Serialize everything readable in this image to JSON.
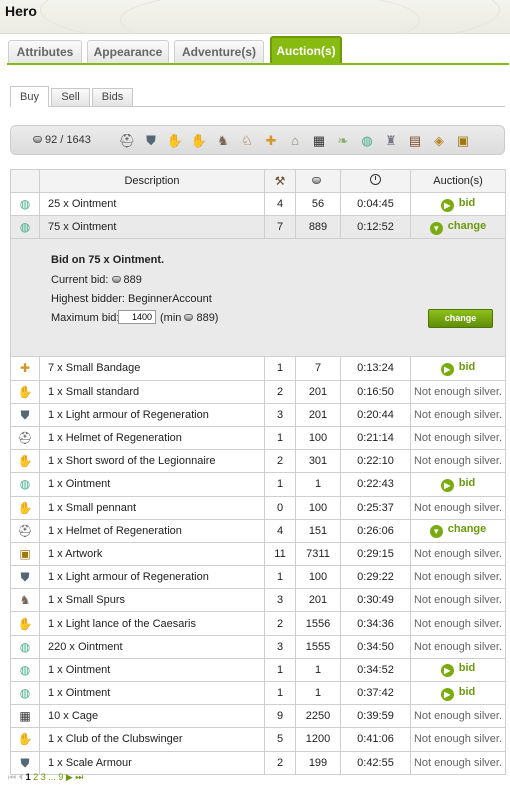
{
  "header": {
    "title": "Hero"
  },
  "main_tabs": [
    {
      "label": "Attributes",
      "active": false
    },
    {
      "label": "Appearance",
      "active": false
    },
    {
      "label": "Adventure(s)",
      "active": false
    },
    {
      "label": "Auction(s)",
      "active": true
    }
  ],
  "sub_tabs": [
    {
      "label": "Buy",
      "active": true
    },
    {
      "label": "Sell",
      "active": false
    },
    {
      "label": "Bids",
      "active": false
    }
  ],
  "filter_bar": {
    "silver": "92 / 1643",
    "icons": [
      "helmet-icon",
      "armour-icon",
      "left-hand-icon",
      "right-hand-icon",
      "shoes-icon",
      "horse-icon",
      "bandage-icon",
      "bird-cage-icon",
      "cage-icon",
      "scroll-icon",
      "ointment-icon",
      "bucket-icon",
      "book-icon",
      "tablet-icon",
      "artwork-icon"
    ]
  },
  "table": {
    "headers": {
      "description": "Description",
      "auctions": "Auction(s)"
    },
    "rows": [
      {
        "icon": "ointment-icon",
        "desc": "25 x Ointment",
        "bids": "4",
        "price": "56",
        "time": "0:04:45",
        "action": "bid"
      },
      {
        "icon": "ointment-icon",
        "desc": "75 x Ointment",
        "bids": "7",
        "price": "889",
        "time": "0:12:52",
        "action": "change",
        "selected": true
      },
      {
        "icon": "bandage-icon",
        "desc": "7 x Small Bandage",
        "bids": "1",
        "price": "7",
        "time": "0:13:24",
        "action": "bid"
      },
      {
        "icon": "left-hand-icon",
        "desc": "1 x Small standard",
        "bids": "2",
        "price": "201",
        "time": "0:16:50",
        "action": "Not enough silver."
      },
      {
        "icon": "armour-icon",
        "desc": "1 x Light armour of Regeneration",
        "bids": "3",
        "price": "201",
        "time": "0:20:44",
        "action": "Not enough silver."
      },
      {
        "icon": "helmet-icon",
        "desc": "1 x Helmet of Regeneration",
        "bids": "1",
        "price": "100",
        "time": "0:21:14",
        "action": "Not enough silver."
      },
      {
        "icon": "right-hand-icon",
        "desc": "1 x Short sword of the Legionnaire",
        "bids": "2",
        "price": "301",
        "time": "0:22:10",
        "action": "Not enough silver."
      },
      {
        "icon": "ointment-icon",
        "desc": "1 x Ointment",
        "bids": "1",
        "price": "1",
        "time": "0:22:43",
        "action": "bid"
      },
      {
        "icon": "left-hand-icon",
        "desc": "1 x Small pennant",
        "bids": "0",
        "price": "100",
        "time": "0:25:37",
        "action": "Not enough silver."
      },
      {
        "icon": "helmet-icon",
        "desc": "1 x Helmet of Regeneration",
        "bids": "4",
        "price": "151",
        "time": "0:26:06",
        "action": "change"
      },
      {
        "icon": "artwork-icon",
        "desc": "1 x Artwork",
        "bids": "11",
        "price": "7311",
        "time": "0:29:15",
        "action": "Not enough silver."
      },
      {
        "icon": "armour-icon",
        "desc": "1 x Light armour of Regeneration",
        "bids": "1",
        "price": "100",
        "time": "0:29:22",
        "action": "Not enough silver."
      },
      {
        "icon": "shoes-icon",
        "desc": "1 x Small Spurs",
        "bids": "3",
        "price": "201",
        "time": "0:30:49",
        "action": "Not enough silver."
      },
      {
        "icon": "right-hand-icon",
        "desc": "1 x Light lance of the Caesaris",
        "bids": "2",
        "price": "1556",
        "time": "0:34:36",
        "action": "Not enough silver."
      },
      {
        "icon": "ointment-icon",
        "desc": "220 x Ointment",
        "bids": "3",
        "price": "1555",
        "time": "0:34:50",
        "action": "Not enough silver."
      },
      {
        "icon": "ointment-icon",
        "desc": "1 x Ointment",
        "bids": "1",
        "price": "1",
        "time": "0:34:52",
        "action": "bid"
      },
      {
        "icon": "ointment-icon",
        "desc": "1 x Ointment",
        "bids": "1",
        "price": "1",
        "time": "0:37:42",
        "action": "bid"
      },
      {
        "icon": "cage-icon",
        "desc": "10 x Cage",
        "bids": "9",
        "price": "2250",
        "time": "0:39:59",
        "action": "Not enough silver."
      },
      {
        "icon": "right-hand-icon",
        "desc": "1 x Club of the Clubswinger",
        "bids": "5",
        "price": "1200",
        "time": "0:41:06",
        "action": "Not enough silver."
      },
      {
        "icon": "armour-icon",
        "desc": "1 x Scale Armour",
        "bids": "2",
        "price": "199",
        "time": "0:42:55",
        "action": "Not enough silver."
      }
    ]
  },
  "bid_panel": {
    "title": "Bid on 75 x Ointment.",
    "current_bid_label": "Current bid:",
    "current_bid_value": "889",
    "highest_bidder": "Highest bidder: BeginnerAccount",
    "max_bid_label": "Maximum bid:",
    "max_bid_value": "1400",
    "min_prefix": "(min",
    "min_value": "889)",
    "button_label": "change"
  },
  "pagination": {
    "first": "⏮",
    "prev": "⏴",
    "current": "1",
    "pages": [
      "2",
      "3"
    ],
    "ellipsis": "...",
    "last_page": "9",
    "next": "▶",
    "last": "⏭"
  },
  "colors": {
    "accent": "#88bb11",
    "link_green": "#6a9a0b"
  }
}
